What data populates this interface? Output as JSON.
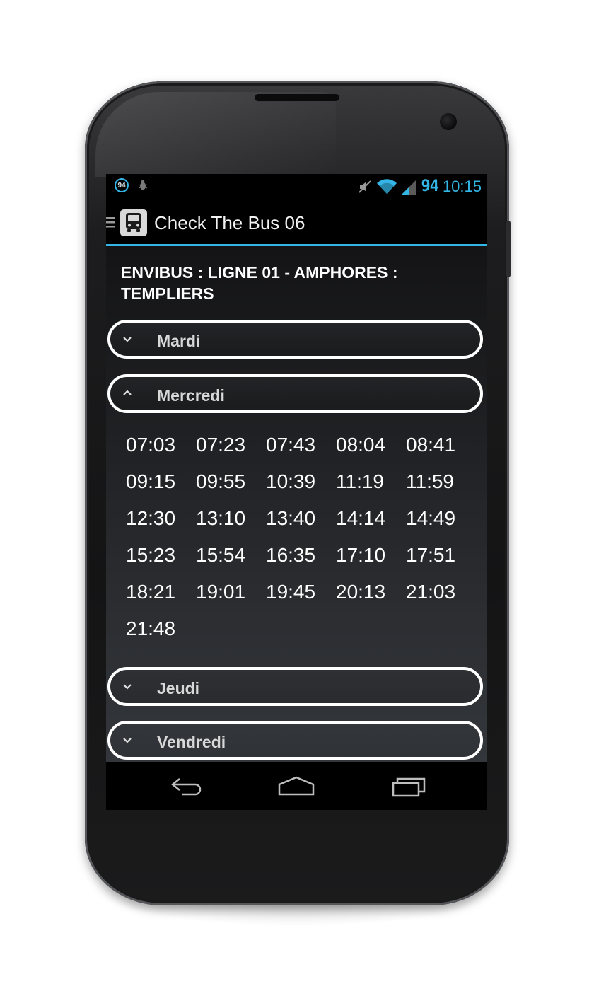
{
  "status_bar": {
    "battery_badge": "94",
    "battery_level": "94",
    "time": "10:15",
    "icons": [
      "bug-icon",
      "mute-icon",
      "wifi-icon",
      "signal-icon"
    ],
    "accent_color": "#33b5e5"
  },
  "action_bar": {
    "title": "Check The Bus 06",
    "icons": [
      "drawer-icon",
      "bus-icon"
    ]
  },
  "line_title": "ENVIBUS : LIGNE 01 - AMPHORES : TEMPLIERS",
  "days": [
    {
      "label": "Mardi",
      "expanded": false
    },
    {
      "label": "Mercredi",
      "expanded": true
    },
    {
      "label": "Jeudi",
      "expanded": false
    },
    {
      "label": "Vendredi",
      "expanded": false
    }
  ],
  "times": [
    "07:03",
    "07:23",
    "07:43",
    "08:04",
    "08:41",
    "09:15",
    "09:55",
    "10:39",
    "11:19",
    "11:59",
    "12:30",
    "13:10",
    "13:40",
    "14:14",
    "14:49",
    "15:23",
    "15:54",
    "16:35",
    "17:10",
    "17:51",
    "18:21",
    "19:01",
    "19:45",
    "20:13",
    "21:03",
    "21:48"
  ],
  "nav_bar": {
    "icons": [
      "back-icon",
      "home-icon",
      "recent-apps-icon"
    ]
  }
}
